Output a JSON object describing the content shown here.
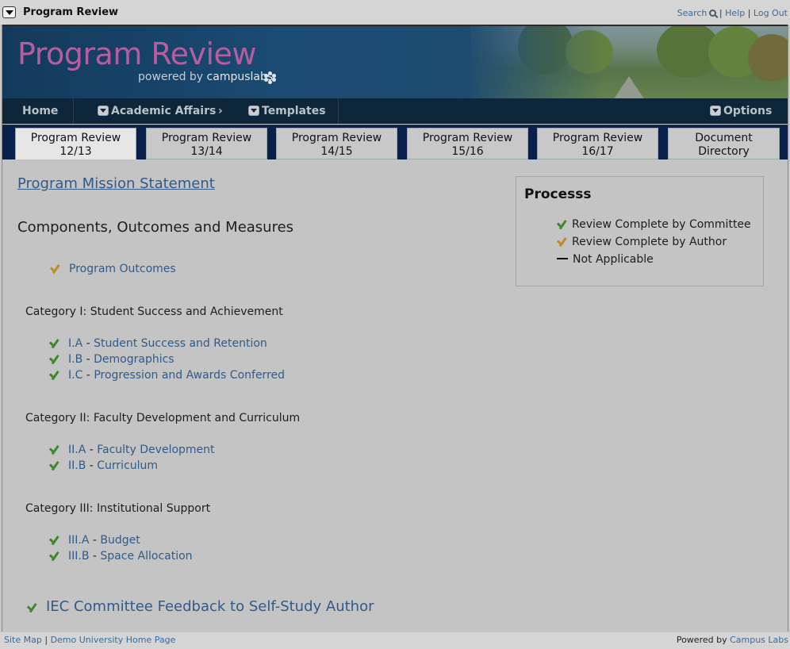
{
  "window": {
    "title": "Program Review"
  },
  "toplinks": {
    "search": "Search",
    "help": "Help",
    "logout": "Log Out",
    "sep": "|"
  },
  "banner": {
    "title": "Program Review",
    "powered_prefix": "powered by ",
    "powered_brand": "campuslabs"
  },
  "nav": {
    "home": "Home",
    "academic_affairs": "Academic Affairs",
    "templates": "Templates",
    "options": "Options"
  },
  "tabs": [
    {
      "line1": "Program Review",
      "line2": "12/13"
    },
    {
      "line1": "Program Review",
      "line2": "13/14"
    },
    {
      "line1": "Program Review",
      "line2": "14/15"
    },
    {
      "line1": "Program Review",
      "line2": "15/16"
    },
    {
      "line1": "Program Review",
      "line2": "16/17"
    },
    {
      "line1": "Document",
      "line2": "Directory"
    }
  ],
  "main": {
    "mission": "Program Mission Statement",
    "section_title": "Components, Outcomes and Measures",
    "program_outcomes": "Program Outcomes",
    "categories": [
      {
        "title": "Category I: Student Success and Achievement",
        "items": [
          {
            "code": "I.A",
            "label": "Student Success and Retention"
          },
          {
            "code": "I.B",
            "label": "Demographics"
          },
          {
            "code": "I.C",
            "label": "Progression and Awards Conferred"
          }
        ]
      },
      {
        "title": "Category II: Faculty Development and Curriculum",
        "items": [
          {
            "code": "II.A",
            "label": "Faculty Development"
          },
          {
            "code": "II.B",
            "label": "Curriculum"
          }
        ]
      },
      {
        "title": "Category III: Institutional Support",
        "items": [
          {
            "code": "III.A",
            "label": "Budget"
          },
          {
            "code": "III.B",
            "label": "Space Allocation"
          }
        ]
      }
    ],
    "item_dash": " - ",
    "feedback": "IEC Committee Feedback to Self-Study Author"
  },
  "legend": {
    "title": "Processs",
    "committee": "Review Complete by Committee",
    "author": "Review Complete by Author",
    "na": "Not Applicable"
  },
  "footer": {
    "sitemap": "Site Map",
    "home_page": "Demo University Home Page",
    "powered_by": "Powered by ",
    "campus_labs": "Campus Labs",
    "sep": "|"
  },
  "colors": {
    "link": "#2f5a8a",
    "check_green": "#3f8a28",
    "check_gold": "#c48a2a",
    "nav_bg": "#0e2639",
    "tab_strip": "#08204a"
  }
}
